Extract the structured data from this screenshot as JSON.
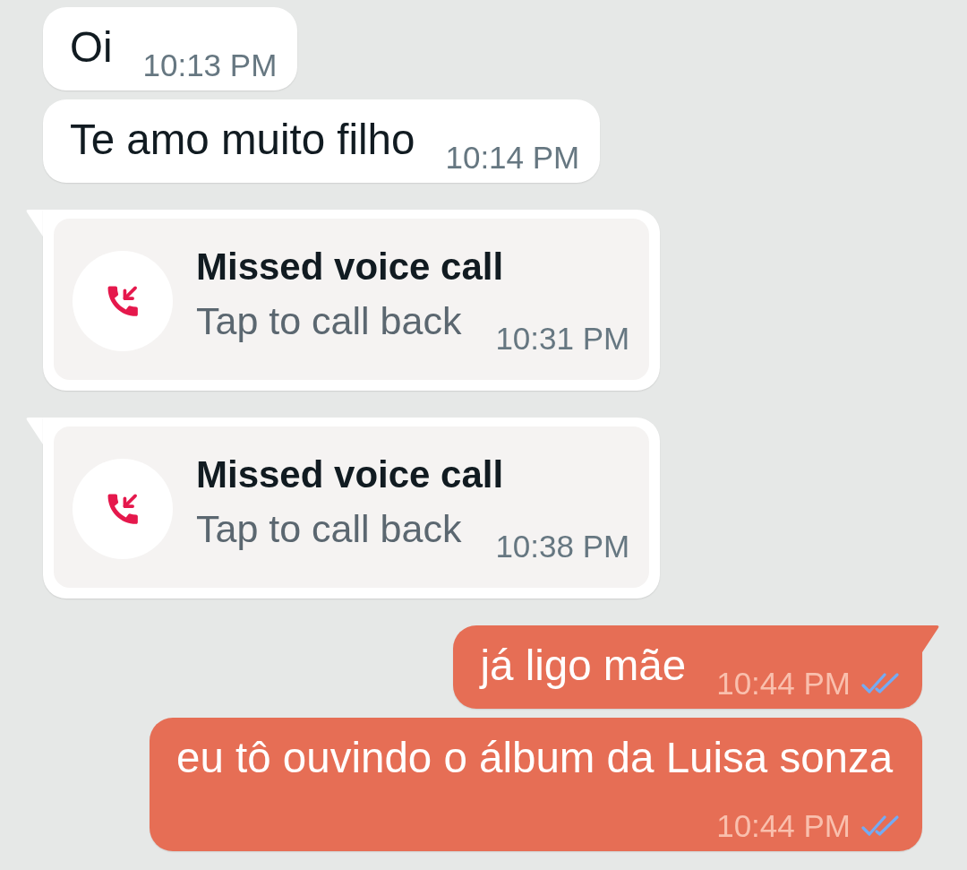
{
  "messages": [
    {
      "kind": "text",
      "outgoing": false,
      "tail": false,
      "text": "Oi",
      "time": "10:13 PM"
    },
    {
      "kind": "text",
      "outgoing": false,
      "tail": false,
      "text": "Te amo muito filho",
      "time": "10:14 PM"
    },
    {
      "kind": "missed_call",
      "outgoing": false,
      "tail": true,
      "title": "Missed voice call",
      "subtitle": "Tap to call back",
      "time": "10:31 PM"
    },
    {
      "kind": "missed_call",
      "outgoing": false,
      "tail": true,
      "title": "Missed voice call",
      "subtitle": "Tap to call back",
      "time": "10:38 PM"
    },
    {
      "kind": "text",
      "outgoing": true,
      "tail": true,
      "text": "já ligo mãe",
      "time": "10:44 PM",
      "read": true
    },
    {
      "kind": "text",
      "outgoing": true,
      "tail": false,
      "text": "eu tô ouvindo o álbum da Luisa sonza",
      "time": "10:44 PM",
      "read": true
    }
  ]
}
